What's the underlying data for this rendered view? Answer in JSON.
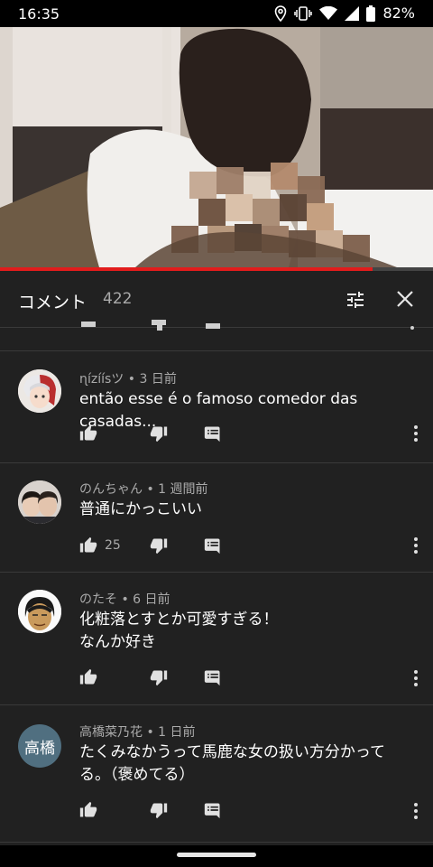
{
  "status_bar": {
    "time": "16:35",
    "battery": "82%",
    "icons": [
      "location-icon",
      "vibrate-icon",
      "wifi-icon",
      "signal-icon",
      "battery-icon"
    ]
  },
  "video": {
    "progress": 0.86,
    "progress_color": "#e21c1c"
  },
  "comments_header": {
    "title": "コメント",
    "count": "422",
    "icons": [
      "filter-icon",
      "close-icon"
    ]
  },
  "comments": [
    {
      "author": "ɳízíísツ",
      "time": "3 日前",
      "text": "então esse é o famoso comedor das casadas...",
      "likes": "",
      "avatar_text": ""
    },
    {
      "author": "のんちゃん",
      "time": "1 週間前",
      "text": "普通にかっこいい",
      "likes": "25",
      "avatar_text": ""
    },
    {
      "author": "のたそ",
      "time": "6 日前",
      "text": "化粧落とすとか可愛すぎる！\nなんか好き",
      "likes": "",
      "avatar_text": ""
    },
    {
      "author": "高橋菜乃花",
      "time": "1 日前",
      "text": "たくみなかうって馬鹿な女の扱い方分かってる。（褒めてる）",
      "likes": "",
      "avatar_text": "高橋"
    }
  ],
  "separator": " • "
}
